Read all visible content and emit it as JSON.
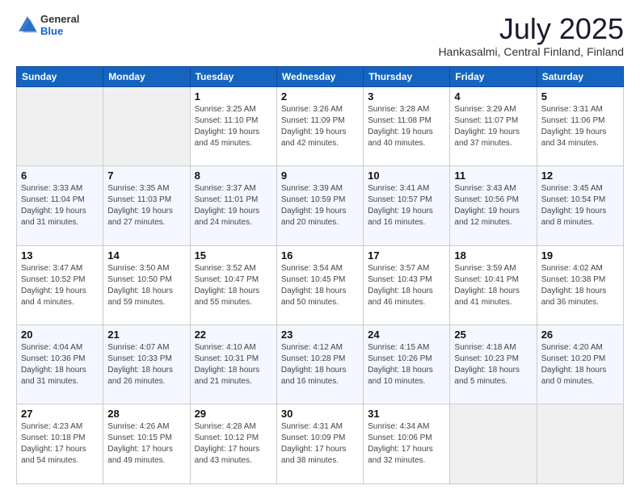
{
  "header": {
    "logo_general": "General",
    "logo_blue": "Blue",
    "month": "July 2025",
    "location": "Hankasalmi, Central Finland, Finland"
  },
  "weekdays": [
    "Sunday",
    "Monday",
    "Tuesday",
    "Wednesday",
    "Thursday",
    "Friday",
    "Saturday"
  ],
  "weeks": [
    [
      {
        "day": "",
        "info": ""
      },
      {
        "day": "",
        "info": ""
      },
      {
        "day": "1",
        "info": "Sunrise: 3:25 AM\nSunset: 11:10 PM\nDaylight: 19 hours\nand 45 minutes."
      },
      {
        "day": "2",
        "info": "Sunrise: 3:26 AM\nSunset: 11:09 PM\nDaylight: 19 hours\nand 42 minutes."
      },
      {
        "day": "3",
        "info": "Sunrise: 3:28 AM\nSunset: 11:08 PM\nDaylight: 19 hours\nand 40 minutes."
      },
      {
        "day": "4",
        "info": "Sunrise: 3:29 AM\nSunset: 11:07 PM\nDaylight: 19 hours\nand 37 minutes."
      },
      {
        "day": "5",
        "info": "Sunrise: 3:31 AM\nSunset: 11:06 PM\nDaylight: 19 hours\nand 34 minutes."
      }
    ],
    [
      {
        "day": "6",
        "info": "Sunrise: 3:33 AM\nSunset: 11:04 PM\nDaylight: 19 hours\nand 31 minutes."
      },
      {
        "day": "7",
        "info": "Sunrise: 3:35 AM\nSunset: 11:03 PM\nDaylight: 19 hours\nand 27 minutes."
      },
      {
        "day": "8",
        "info": "Sunrise: 3:37 AM\nSunset: 11:01 PM\nDaylight: 19 hours\nand 24 minutes."
      },
      {
        "day": "9",
        "info": "Sunrise: 3:39 AM\nSunset: 10:59 PM\nDaylight: 19 hours\nand 20 minutes."
      },
      {
        "day": "10",
        "info": "Sunrise: 3:41 AM\nSunset: 10:57 PM\nDaylight: 19 hours\nand 16 minutes."
      },
      {
        "day": "11",
        "info": "Sunrise: 3:43 AM\nSunset: 10:56 PM\nDaylight: 19 hours\nand 12 minutes."
      },
      {
        "day": "12",
        "info": "Sunrise: 3:45 AM\nSunset: 10:54 PM\nDaylight: 19 hours\nand 8 minutes."
      }
    ],
    [
      {
        "day": "13",
        "info": "Sunrise: 3:47 AM\nSunset: 10:52 PM\nDaylight: 19 hours\nand 4 minutes."
      },
      {
        "day": "14",
        "info": "Sunrise: 3:50 AM\nSunset: 10:50 PM\nDaylight: 18 hours\nand 59 minutes."
      },
      {
        "day": "15",
        "info": "Sunrise: 3:52 AM\nSunset: 10:47 PM\nDaylight: 18 hours\nand 55 minutes."
      },
      {
        "day": "16",
        "info": "Sunrise: 3:54 AM\nSunset: 10:45 PM\nDaylight: 18 hours\nand 50 minutes."
      },
      {
        "day": "17",
        "info": "Sunrise: 3:57 AM\nSunset: 10:43 PM\nDaylight: 18 hours\nand 46 minutes."
      },
      {
        "day": "18",
        "info": "Sunrise: 3:59 AM\nSunset: 10:41 PM\nDaylight: 18 hours\nand 41 minutes."
      },
      {
        "day": "19",
        "info": "Sunrise: 4:02 AM\nSunset: 10:38 PM\nDaylight: 18 hours\nand 36 minutes."
      }
    ],
    [
      {
        "day": "20",
        "info": "Sunrise: 4:04 AM\nSunset: 10:36 PM\nDaylight: 18 hours\nand 31 minutes."
      },
      {
        "day": "21",
        "info": "Sunrise: 4:07 AM\nSunset: 10:33 PM\nDaylight: 18 hours\nand 26 minutes."
      },
      {
        "day": "22",
        "info": "Sunrise: 4:10 AM\nSunset: 10:31 PM\nDaylight: 18 hours\nand 21 minutes."
      },
      {
        "day": "23",
        "info": "Sunrise: 4:12 AM\nSunset: 10:28 PM\nDaylight: 18 hours\nand 16 minutes."
      },
      {
        "day": "24",
        "info": "Sunrise: 4:15 AM\nSunset: 10:26 PM\nDaylight: 18 hours\nand 10 minutes."
      },
      {
        "day": "25",
        "info": "Sunrise: 4:18 AM\nSunset: 10:23 PM\nDaylight: 18 hours\nand 5 minutes."
      },
      {
        "day": "26",
        "info": "Sunrise: 4:20 AM\nSunset: 10:20 PM\nDaylight: 18 hours\nand 0 minutes."
      }
    ],
    [
      {
        "day": "27",
        "info": "Sunrise: 4:23 AM\nSunset: 10:18 PM\nDaylight: 17 hours\nand 54 minutes."
      },
      {
        "day": "28",
        "info": "Sunrise: 4:26 AM\nSunset: 10:15 PM\nDaylight: 17 hours\nand 49 minutes."
      },
      {
        "day": "29",
        "info": "Sunrise: 4:28 AM\nSunset: 10:12 PM\nDaylight: 17 hours\nand 43 minutes."
      },
      {
        "day": "30",
        "info": "Sunrise: 4:31 AM\nSunset: 10:09 PM\nDaylight: 17 hours\nand 38 minutes."
      },
      {
        "day": "31",
        "info": "Sunrise: 4:34 AM\nSunset: 10:06 PM\nDaylight: 17 hours\nand 32 minutes."
      },
      {
        "day": "",
        "info": ""
      },
      {
        "day": "",
        "info": ""
      }
    ]
  ]
}
